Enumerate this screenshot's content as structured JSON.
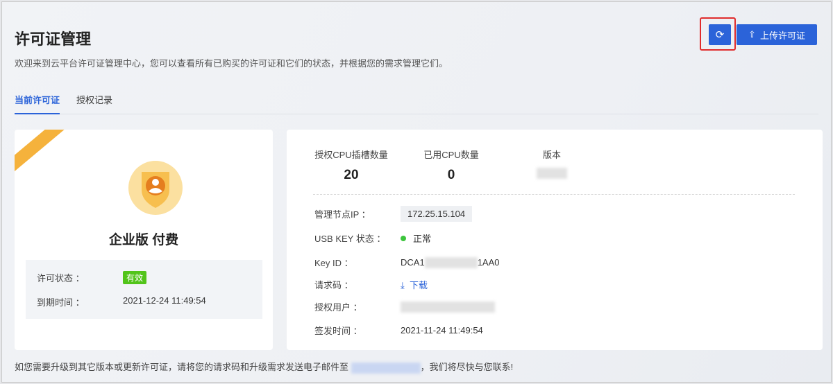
{
  "header": {
    "title": "许可证管理",
    "description": "欢迎来到云平台许可证管理中心，您可以查看所有已购买的许可证和它们的状态，并根据您的需求管理它们。",
    "refresh_icon": "refresh-icon",
    "upload_label": "上传许可证"
  },
  "tabs": [
    {
      "label": "当前许可证",
      "active": true
    },
    {
      "label": "授权记录",
      "active": false
    }
  ],
  "license": {
    "edition": "企业版 付费",
    "status_label": "许可状态 ：",
    "status": "有效",
    "expire_label": "到期时间 ：",
    "expire": "2021-12-24 11:49:54",
    "status_color": "#52c41a"
  },
  "stats": [
    {
      "label": "授权CPU插槽数量",
      "value": "20"
    },
    {
      "label": "已用CPU数量",
      "value": "0"
    },
    {
      "label": "版本",
      "value": ""
    }
  ],
  "details": {
    "ip_label": "管理节点IP ：",
    "ip": "172.25.15.104",
    "usb_label": "USB KEY 状态 ：",
    "usb": "正常",
    "keyid_label": "Key ID ：",
    "keyid_prefix": "DCA1",
    "keyid_suffix": "1AA0",
    "req_label": "请求码 ：",
    "req_link": "下载",
    "user_label": "授权用户 ：",
    "issue_label": "签发时间 ：",
    "issue": "2021-11-24 11:49:54"
  },
  "footer": {
    "text_before": "如您需要升级到其它版本或更新许可证，请将您的请求码和升级需求发送电子邮件至",
    "text_after": "，我们将尽快与您联系!"
  },
  "colors": {
    "primary": "#2b63d9",
    "highlight": "#e02b2b"
  }
}
